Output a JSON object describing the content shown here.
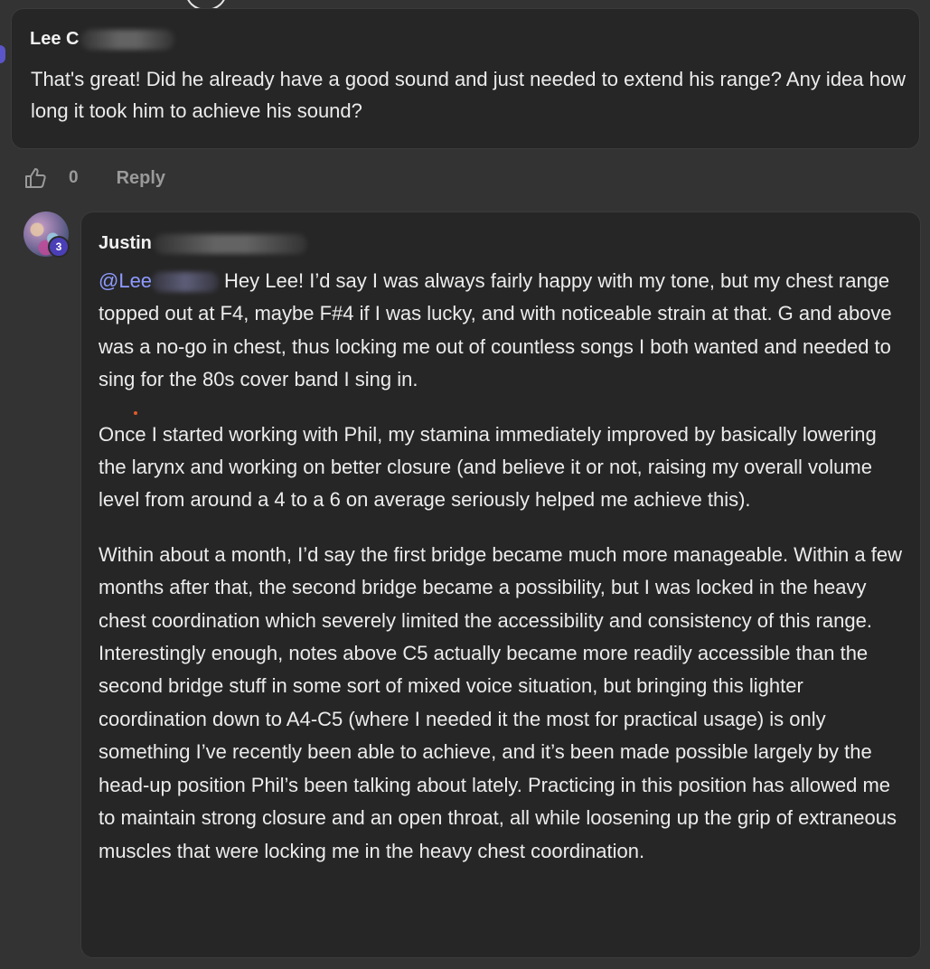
{
  "comment1": {
    "author": "Lee C",
    "body": "That's great! Did he already have a good sound and just needed to extend his range? Any idea how long it took him to achieve his sound?",
    "like_count": "0",
    "reply_label": "Reply"
  },
  "comment2": {
    "author": "Justin",
    "avatar_badge": "3",
    "mention": "@Lee",
    "paragraph1_rest": "Hey Lee! I’d say I was always fairly happy with my tone, but my chest range topped out at F4, maybe F#4 if I was lucky, and with noticeable strain at that. G and above was a no-go in chest, thus locking me out of countless songs I both wanted and needed to sing for the 80s cover band I sing in.",
    "paragraph2": "Once I started working with Phil, my stamina immediately improved by basically lowering the larynx and working on better closure (and believe it or not, raising my overall volume level from around a 4 to a 6 on average seriously helped me achieve this).",
    "paragraph3": "Within about a month, I’d say the first bridge became much more manageable. Within a few months after that, the second bridge became a possibility, but I was locked in the heavy chest coordination which severely limited the accessibility and consistency of this range. Interestingly enough, notes above C5 actually became more readily accessible than the second bridge stuff in some sort of mixed voice situation, but bringing this lighter coordination down to A4-C5 (where I needed it the most for practical usage) is only something I’ve recently been able to achieve, and it’s been made possible largely by the head-up position Phil’s been talking about lately. Practicing in this position has allowed me to maintain strong closure and an open throat, all while loosening up the grip of extraneous muscles that were locking me in the heavy chest coordination."
  },
  "icons": {
    "like": "thumbs-up-icon"
  },
  "colors": {
    "background": "#333333",
    "card": "#262626",
    "mention": "#8e9bff",
    "badge": "#4b3fb8"
  }
}
